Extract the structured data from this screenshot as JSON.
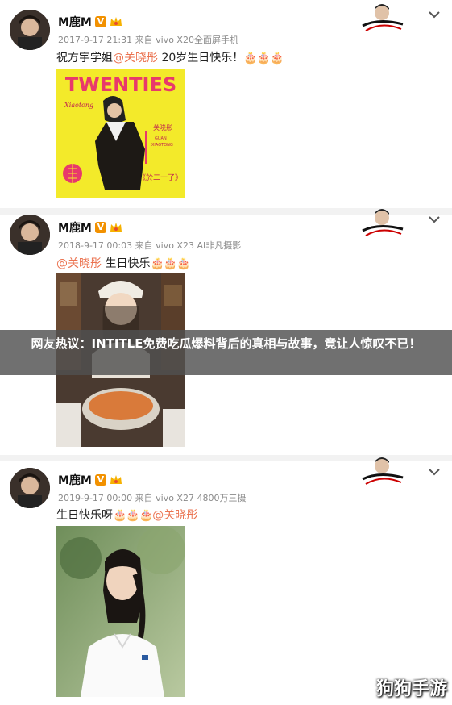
{
  "posts": [
    {
      "username": "M鹿M",
      "meta": "2017-9-17 21:31 来自 vivo X20全面屏手机",
      "text_prefix": "祝方宇学姐",
      "mention": "@关晓彤",
      "text_suffix": " 20岁生日快乐！",
      "cakes": "🎂🎂🎂",
      "image": {
        "headline": "TWENTIES",
        "script": "Xiaotong",
        "name_cn": "关晓彤",
        "name_en1": "GUAN",
        "name_en2": "XIAOTONG",
        "caption": "《於二十了》"
      }
    },
    {
      "username": "M鹿M",
      "meta": "2018-9-17 00:03 来自 vivo X23 AI非凡摄影",
      "mention": "@关晓彤",
      "text_suffix": " 生日快乐",
      "cakes": "🎂🎂🎂"
    },
    {
      "username": "M鹿M",
      "meta": "2019-9-17 00:00 来自 vivo X27 4800万三摄",
      "text_prefix": "生日快乐呀",
      "cakes": "🎂🎂🎂",
      "mention": "@关晓彤"
    }
  ],
  "badge_v": "V",
  "overlay_text": "网友热议：INTITLE免费吃瓜爆料背后的真相与故事，竟让人惊叹不已！",
  "watermark": "狗狗手游",
  "icons": [
    "avatar",
    "verified-badge",
    "crown-icon",
    "chevron-down-icon",
    "signature-logo"
  ],
  "colors": {
    "mention": "#eb7350",
    "meta": "#8a8a8a",
    "poster_yellow": "#f3ea2a",
    "poster_pink": "#e8396b",
    "overlay": "#505050"
  }
}
